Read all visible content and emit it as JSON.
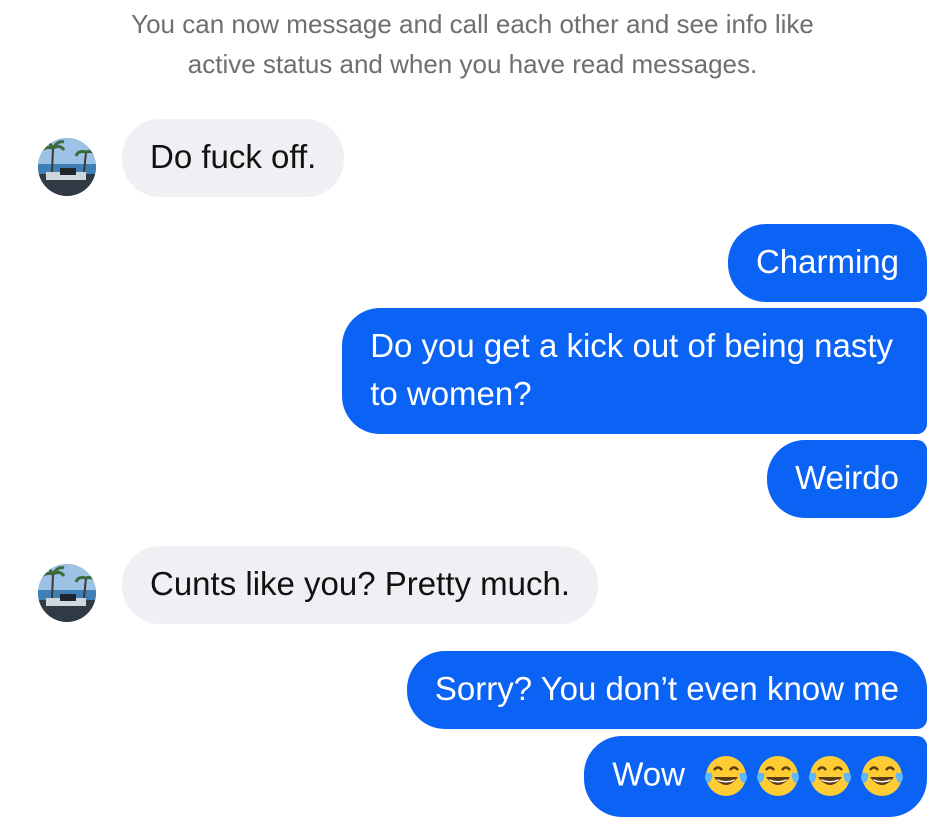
{
  "system_notice": {
    "line1": "You can now message and call each other and see info like",
    "line2": "active status and when you have read messages."
  },
  "messages": [
    {
      "direction": "incoming",
      "text": "Do fuck off."
    },
    {
      "direction": "outgoing",
      "text": "Charming"
    },
    {
      "direction": "outgoing",
      "text": "Do you get a kick out of being nasty",
      "text_line2": "to women?"
    },
    {
      "direction": "outgoing",
      "text": "Weirdo"
    },
    {
      "direction": "incoming",
      "text": "Cunts like you? Pretty much."
    },
    {
      "direction": "outgoing",
      "text": "Sorry? You don’t even know me"
    },
    {
      "direction": "outgoing",
      "text": "Wow",
      "emoji": [
        "face-with-tears-of-joy",
        "face-with-tears-of-joy",
        "face-with-tears-of-joy",
        "face-with-tears-of-joy"
      ]
    }
  ],
  "colors": {
    "outgoing_bubble": "#0a63f5",
    "incoming_bubble": "#eef0f3",
    "notice_text": "#6e6e73"
  }
}
